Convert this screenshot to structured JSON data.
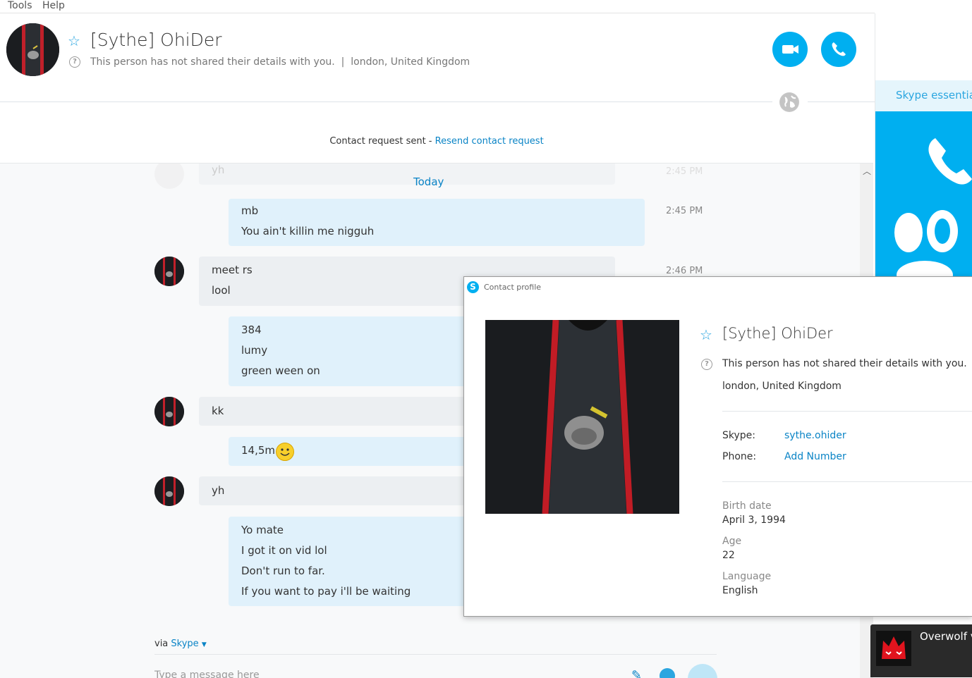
{
  "menu": {
    "tools": "Tools",
    "help": "Help"
  },
  "header": {
    "name": "[Sythe] OhiDer",
    "status_text": "This person has not shared their details with you.",
    "separator": "|",
    "location": "london, United Kingdom"
  },
  "contact_request": {
    "sent": "Contact request sent - ",
    "resend": "Resend contact request"
  },
  "conversation": {
    "faded_msg": "yh",
    "faded_time": "2:45 PM",
    "today": "Today",
    "messages": [
      {
        "lines": [
          "mb",
          "You ain't killin me nigguh"
        ],
        "time": "2:45 PM"
      },
      {
        "lines": [
          "meet rs",
          "lool"
        ],
        "time": "2:46 PM"
      },
      {
        "lines": [
          "384",
          "lumy",
          "green ween on"
        ]
      },
      {
        "lines": [
          "kk"
        ]
      },
      {
        "lines": [
          "14,5m"
        ]
      },
      {
        "lines": [
          "yh"
        ]
      },
      {
        "lines": [
          "Yo mate",
          "I got it on vid lol",
          "Don't run to far.",
          "If you want to pay i'll be waiting"
        ]
      }
    ],
    "via": "via ",
    "via_service": "Skype",
    "compose_placeholder": "Type a message here"
  },
  "ad": {
    "banner": "Skype essentia"
  },
  "profile_popup": {
    "window_title": "Contact profile",
    "name": "[Sythe] OhiDer",
    "status_text": "This person has not shared their details with you.",
    "location": "london, United Kingdom",
    "skype_label": "Skype:",
    "skype_value": "sythe.ohider",
    "phone_label": "Phone:",
    "phone_value": "Add Number",
    "birth_label": "Birth date",
    "birth_value": "April 3, 1994",
    "age_label": "Age",
    "age_value": "22",
    "language_label": "Language",
    "language_value": "English"
  },
  "overwolf": {
    "label": "Overwolf v"
  },
  "colors": {
    "accent": "#00aff0",
    "link": "#0a84c6",
    "bubble_me": "#e0f1fb",
    "bubble_them": "#eceff2"
  },
  "icons": [
    "star-icon",
    "help-circle-icon",
    "video-call-icon",
    "audio-call-icon",
    "globe-icon",
    "smiley-icon",
    "skype-logo-icon",
    "chevron-up-icon",
    "attach-icon",
    "overwolf-logo-icon"
  ]
}
